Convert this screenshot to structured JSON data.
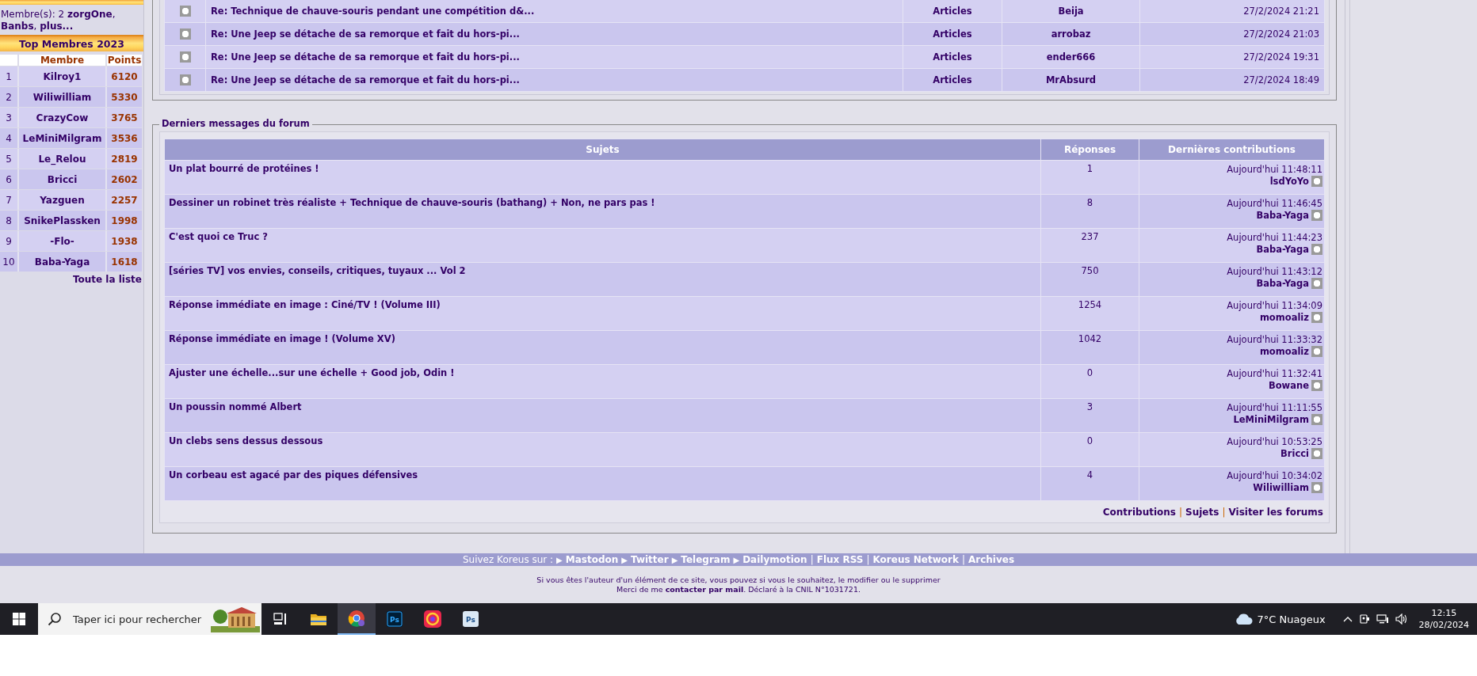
{
  "online": {
    "text": "Membre(s): 2 **zorgOne**, **Banbs**, **plus...**"
  },
  "top_members": {
    "title": "Top Membres 2023",
    "columns": [
      "Membre",
      "Points"
    ],
    "rows": [
      {
        "rank": "1",
        "member": "Kilroy1",
        "points": "6120"
      },
      {
        "rank": "2",
        "member": "Wiliwilliam",
        "points": "5330"
      },
      {
        "rank": "3",
        "member": "CrazyCow",
        "points": "3765"
      },
      {
        "rank": "4",
        "member": "LeMiniMilgram",
        "points": "3536"
      },
      {
        "rank": "5",
        "member": "Le_Relou",
        "points": "2819"
      },
      {
        "rank": "6",
        "member": "Bricci",
        "points": "2602"
      },
      {
        "rank": "7",
        "member": "Yazguen",
        "points": "2257"
      },
      {
        "rank": "8",
        "member": "SnikePlassken",
        "points": "1998"
      },
      {
        "rank": "9",
        "member": "-Flo-",
        "points": "1938"
      },
      {
        "rank": "10",
        "member": "Baba-Yaga",
        "points": "1618"
      }
    ],
    "link": "Toute la liste"
  },
  "recent_comments": {
    "rows": [
      {
        "title": "Re: Technique de chauve-souris pendant une compétition d&...",
        "section": "Articles",
        "author": "Beija",
        "date": "27/2/2024 21:21"
      },
      {
        "title": "Re: Une Jeep se détache de sa remorque et fait du hors-pi...",
        "section": "Articles",
        "author": "arrobaz",
        "date": "27/2/2024 21:03"
      },
      {
        "title": "Re: Une Jeep se détache de sa remorque et fait du hors-pi...",
        "section": "Articles",
        "author": "ender666",
        "date": "27/2/2024 19:31"
      },
      {
        "title": "Re: Une Jeep se détache de sa remorque et fait du hors-pi...",
        "section": "Articles",
        "author": "MrAbsurd",
        "date": "27/2/2024 18:49"
      }
    ]
  },
  "forum": {
    "legend": "Derniers messages du forum",
    "columns": [
      "Sujets",
      "Réponses",
      "Dernières contributions"
    ],
    "rows": [
      {
        "subject": "Un plat bourré de protéines !",
        "replies": "1",
        "date": "Aujourd'hui 11:48:11",
        "author": "lsdYoYo"
      },
      {
        "subject": "Dessiner un robinet très réaliste + Technique de chauve-souris (bathang) + Non, ne pars pas !",
        "replies": "8",
        "date": "Aujourd'hui 11:46:45",
        "author": "Baba-Yaga"
      },
      {
        "subject": "C'est quoi ce Truc ?",
        "replies": "237",
        "date": "Aujourd'hui 11:44:23",
        "author": "Baba-Yaga"
      },
      {
        "subject": "[séries TV] vos envies, conseils, critiques, tuyaux ... Vol 2",
        "replies": "750",
        "date": "Aujourd'hui 11:43:12",
        "author": "Baba-Yaga"
      },
      {
        "subject": "Réponse immédiate en image : Ciné/TV ! (Volume III)",
        "replies": "1254",
        "date": "Aujourd'hui 11:34:09",
        "author": "momoaliz"
      },
      {
        "subject": "Réponse immédiate en image ! (Volume XV)",
        "replies": "1042",
        "date": "Aujourd'hui 11:33:32",
        "author": "momoaliz"
      },
      {
        "subject": "Ajuster une échelle...sur une échelle + Good job, Odin !",
        "replies": "0",
        "date": "Aujourd'hui 11:32:41",
        "author": "Bowane"
      },
      {
        "subject": "Un poussin nommé Albert",
        "replies": "3",
        "date": "Aujourd'hui 11:11:55",
        "author": "LeMiniMilgram"
      },
      {
        "subject": "Un clebs sens dessus dessous",
        "replies": "0",
        "date": "Aujourd'hui 10:53:25",
        "author": "Bricci"
      },
      {
        "subject": "Un corbeau est agacé par des piques défensives",
        "replies": "4",
        "date": "Aujourd'hui 10:34:02",
        "author": "Wiliwilliam"
      }
    ],
    "links": [
      {
        "label": "Contributions"
      },
      {
        "sep": "|",
        "label": "Sujets"
      },
      {
        "sep": "|",
        "label": "Visiter les forums"
      }
    ]
  },
  "footer": {
    "follow_label": "Suivez Koreus sur :",
    "links": [
      {
        "sep": "▶",
        "label": "Mastodon"
      },
      {
        "sep": "▶",
        "label": "Twitter"
      },
      {
        "sep": "▶",
        "label": "Telegram"
      },
      {
        "sep": "▶",
        "label": "Dailymotion"
      },
      {
        "sep": "|",
        "label": "Flux RSS"
      },
      {
        "sep": "|",
        "label": "Koreus Network"
      },
      {
        "sep": "|",
        "label": "Archives"
      }
    ],
    "notice": "Si vous êtes l'auteur d'un élément de ce site, vous pouvez si vous le souhaitez, le modifier ou le supprimer",
    "contact": {
      "before": "Merci de me ",
      "link": "contacter par mail",
      "after": ". Déclaré à la CNIL N°1031721."
    }
  },
  "taskbar": {
    "search_placeholder": "Taper ici pour rechercher",
    "apps": [
      {
        "kind": "taskview",
        "active": false
      },
      {
        "kind": "folder",
        "active": false
      },
      {
        "kind": "browser",
        "active": true
      },
      {
        "kind": "psdark",
        "label": "Ps",
        "active": false
      },
      {
        "kind": "creative",
        "active": false
      },
      {
        "kind": "pslight",
        "label": "Ps",
        "active": false
      }
    ],
    "weather": "7°C Nuageux",
    "time": "12:15",
    "date": "28/02/2024"
  }
}
